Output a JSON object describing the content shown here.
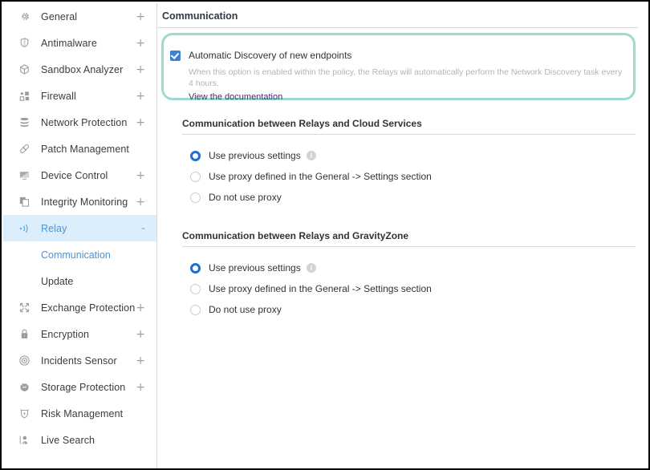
{
  "window": {
    "title": "Communication"
  },
  "sidebar": {
    "items": [
      {
        "label": "General",
        "icon": "gear-icon",
        "expander": "+",
        "active": false
      },
      {
        "label": "Antimalware",
        "icon": "shield-icon",
        "expander": "+",
        "active": false
      },
      {
        "label": "Sandbox Analyzer",
        "icon": "cube-icon",
        "expander": "+",
        "active": false
      },
      {
        "label": "Firewall",
        "icon": "blocks-icon",
        "expander": "+",
        "active": false
      },
      {
        "label": "Network Protection",
        "icon": "stack-icon",
        "expander": "+",
        "active": false
      },
      {
        "label": "Patch Management",
        "icon": "bandage-icon",
        "expander": "",
        "active": false
      },
      {
        "label": "Device Control",
        "icon": "monitor-icon",
        "expander": "+",
        "active": false
      },
      {
        "label": "Integrity Monitoring",
        "icon": "copy-icon",
        "expander": "+",
        "active": false
      },
      {
        "label": "Relay",
        "icon": "relay-icon",
        "expander": "-",
        "active": true
      },
      {
        "label": "Exchange Protection",
        "icon": "exchange-icon",
        "expander": "+",
        "active": false
      },
      {
        "label": "Encryption",
        "icon": "lock-icon",
        "expander": "+",
        "active": false
      },
      {
        "label": "Incidents Sensor",
        "icon": "target-icon",
        "expander": "+",
        "active": false
      },
      {
        "label": "Storage Protection",
        "icon": "storage-icon",
        "expander": "+",
        "active": false
      },
      {
        "label": "Risk Management",
        "icon": "risk-icon",
        "expander": "",
        "active": false
      },
      {
        "label": "Live Search",
        "icon": "search-person-icon",
        "expander": "",
        "active": false
      }
    ],
    "subitems": [
      {
        "label": "Communication",
        "selected": true
      },
      {
        "label": "Update",
        "selected": false
      }
    ],
    "active_color": "#4a93d6",
    "active_background": "#dceefb"
  },
  "main": {
    "page_title": "Communication",
    "highlight": {
      "border_color": "#9fd9d2",
      "checkbox_label": "Automatic Discovery of new endpoints",
      "checkbox_checked": true,
      "checkbox_color": "#3f7fd4",
      "description": "When this option is enabled within the policy, the Relays will automatically perform the Network Discovery task every 4 hours.",
      "link_label": "View the documentation",
      "link_color": "#4b2a6b"
    },
    "sections": [
      {
        "title": "Communication between Relays and Cloud Services",
        "options": [
          {
            "label": "Use previous settings",
            "checked": true,
            "info": true
          },
          {
            "label": "Use proxy defined in the General -> Settings section",
            "checked": false,
            "info": false
          },
          {
            "label": "Do not use proxy",
            "checked": false,
            "info": false
          }
        ]
      },
      {
        "title": "Communication between Relays and GravityZone",
        "options": [
          {
            "label": "Use previous settings",
            "checked": true,
            "info": true
          },
          {
            "label": "Use proxy defined in the General -> Settings section",
            "checked": false,
            "info": false
          },
          {
            "label": "Do not use proxy",
            "checked": false,
            "info": false
          }
        ]
      }
    ],
    "info_icon_glyph": "i",
    "radio_checked_color": "#1c6fd4"
  }
}
